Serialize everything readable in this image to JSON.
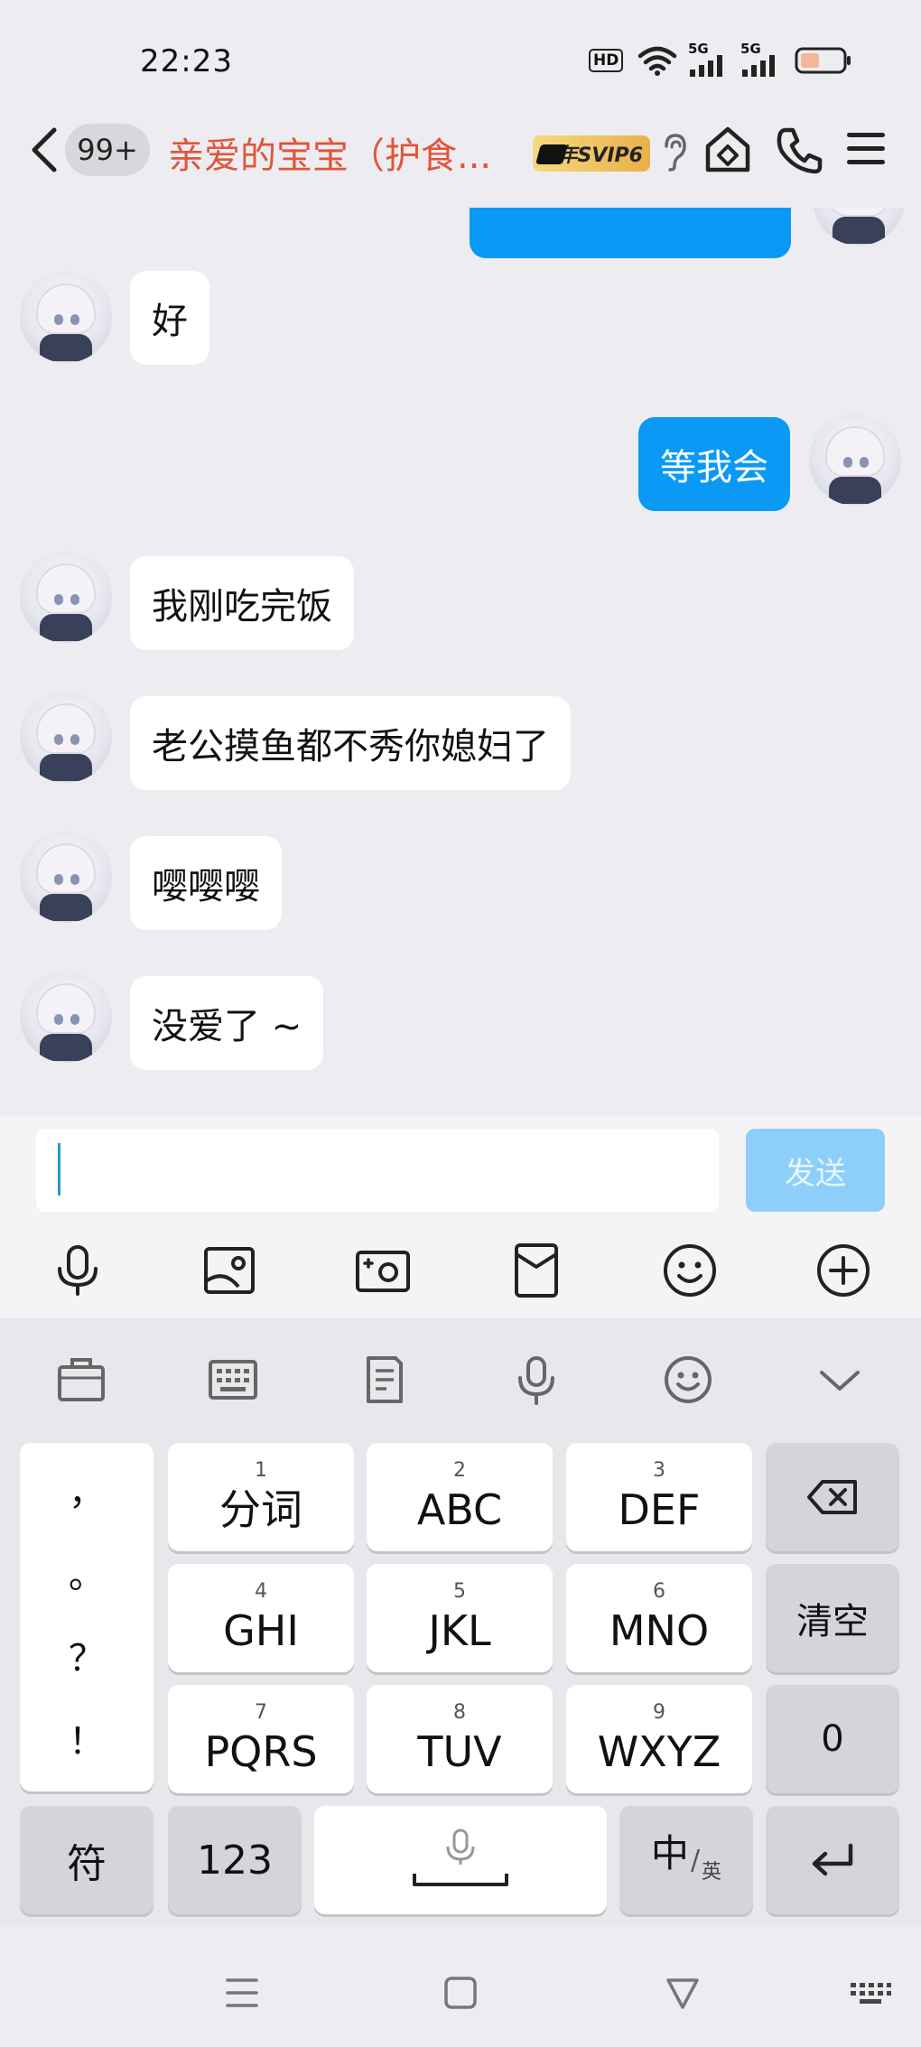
{
  "status_bar": {
    "time": "22:23",
    "hd_label": "HD",
    "signal1_label": "5G",
    "signal2_label": "5G"
  },
  "header": {
    "unread_badge": "99+",
    "title": "亲爱的宝宝（护食...",
    "svip_badge": "年SVIP6",
    "title_color": "#e0553a"
  },
  "messages": [
    {
      "side": "in",
      "text": "好"
    },
    {
      "side": "out",
      "text": "等我会"
    },
    {
      "side": "in",
      "text": "我刚吃完饭"
    },
    {
      "side": "in",
      "text": "老公摸鱼都不秀你媳妇了"
    },
    {
      "side": "in",
      "text": "嘤嘤嘤"
    },
    {
      "side": "in",
      "text": "没爱了 ~"
    }
  ],
  "input": {
    "value": "",
    "send_label": "发送",
    "accent_color": "#0a99f5"
  },
  "toolbar_icons": [
    "voice-icon",
    "image-icon",
    "camera-icon",
    "red-packet-icon",
    "emoji-icon",
    "plus-icon"
  ],
  "keyboard_toolbar_icons": [
    "toolbox-icon",
    "keyboard-layout-icon",
    "clipboard-icon",
    "voice-input-icon",
    "emoji-icon",
    "collapse-icon"
  ],
  "keyboard": {
    "punctuation": [
      "，",
      "。",
      "？",
      "！"
    ],
    "keys": [
      {
        "num": "1",
        "label": "分词"
      },
      {
        "num": "2",
        "label": "ABC"
      },
      {
        "num": "3",
        "label": "DEF"
      },
      {
        "num": "4",
        "label": "GHI"
      },
      {
        "num": "5",
        "label": "JKL"
      },
      {
        "num": "6",
        "label": "MNO"
      },
      {
        "num": "7",
        "label": "PQRS"
      },
      {
        "num": "8",
        "label": "TUV"
      },
      {
        "num": "9",
        "label": "WXYZ"
      }
    ],
    "clear_label": "清空",
    "zero_label": "0",
    "symbol_label": "符",
    "num_label": "123",
    "lang_main": "中",
    "lang_sub": "英"
  }
}
